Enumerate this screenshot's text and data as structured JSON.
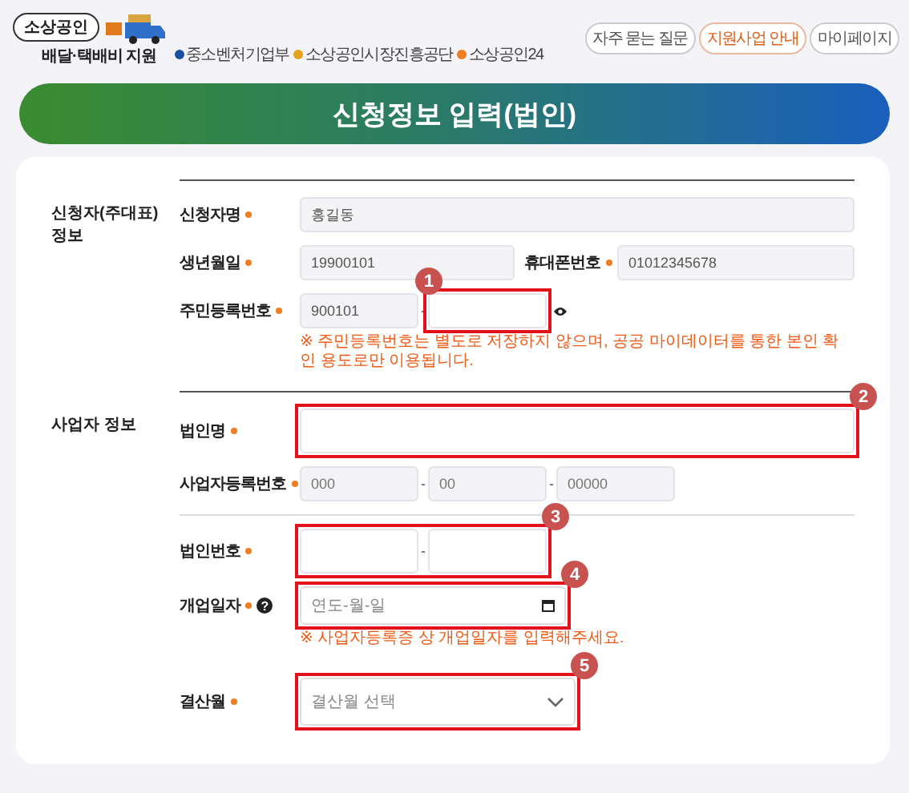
{
  "header": {
    "logo_badge": "소상공인",
    "logo_title": "배달·택배비 지원",
    "agencies": [
      "중소벤처기업부",
      "소상공인시장진흥공단",
      "소상공인24"
    ],
    "buttons": [
      {
        "label": "자주 묻는 질문",
        "highlighted": false
      },
      {
        "label": "지원사업 안내",
        "highlighted": true
      },
      {
        "label": "마이페이지",
        "highlighted": false
      }
    ]
  },
  "banner": {
    "title": "신청정보 입력(법인)"
  },
  "sections": [
    {
      "title": "신청자(주대표) 정보",
      "rows": [
        {
          "kind": "text",
          "label": "신청자명",
          "required": true,
          "inputs": [
            {
              "value": "홍길동"
            }
          ]
        },
        {
          "kind": "pair",
          "label": "생년월일",
          "required": true,
          "inputs": [
            {
              "value": "19900101"
            }
          ],
          "label2": "휴대폰번호",
          "inputs2": [
            {
              "value": "01012345678"
            }
          ]
        },
        {
          "kind": "split",
          "label": "주민등록번호",
          "required": true,
          "reveal": true,
          "inputs": [
            {
              "value": "900101"
            },
            {
              "filled": false,
              "badge": "1"
            }
          ],
          "note": "※ 주민등록번호는 별도로 저장하지 않으며, 공공 마이데이터를 통한 본인 확인 용도로만 이용됩니다."
        }
      ]
    },
    {
      "title": "사업자 정보",
      "rows": [
        {
          "kind": "text",
          "label": "법인명",
          "required": true,
          "badge": "2",
          "inputs": [
            {
              "filled": false
            }
          ]
        },
        {
          "kind": "split",
          "label": "사업자등록번호",
          "required": true,
          "inputs": [
            {
              "placeholder": "000"
            },
            {
              "placeholder": "00"
            },
            {
              "placeholder": "00000"
            }
          ]
        },
        {
          "kind": "split",
          "label": "법인번호",
          "required": true,
          "badge": "3",
          "divider": true,
          "inputs": [
            {
              "filled": false
            },
            {
              "filled": false
            }
          ]
        },
        {
          "kind": "date",
          "label": "개업일자",
          "required": true,
          "help": "?",
          "badge": "4",
          "placeholder": "연도-월-일",
          "note": "※ 사업자등록증 상 개업일자를 입력해주세요."
        },
        {
          "kind": "select",
          "label": "결산월",
          "required": true,
          "badge": "5",
          "placeholder": "결산월 선택"
        }
      ]
    }
  ]
}
